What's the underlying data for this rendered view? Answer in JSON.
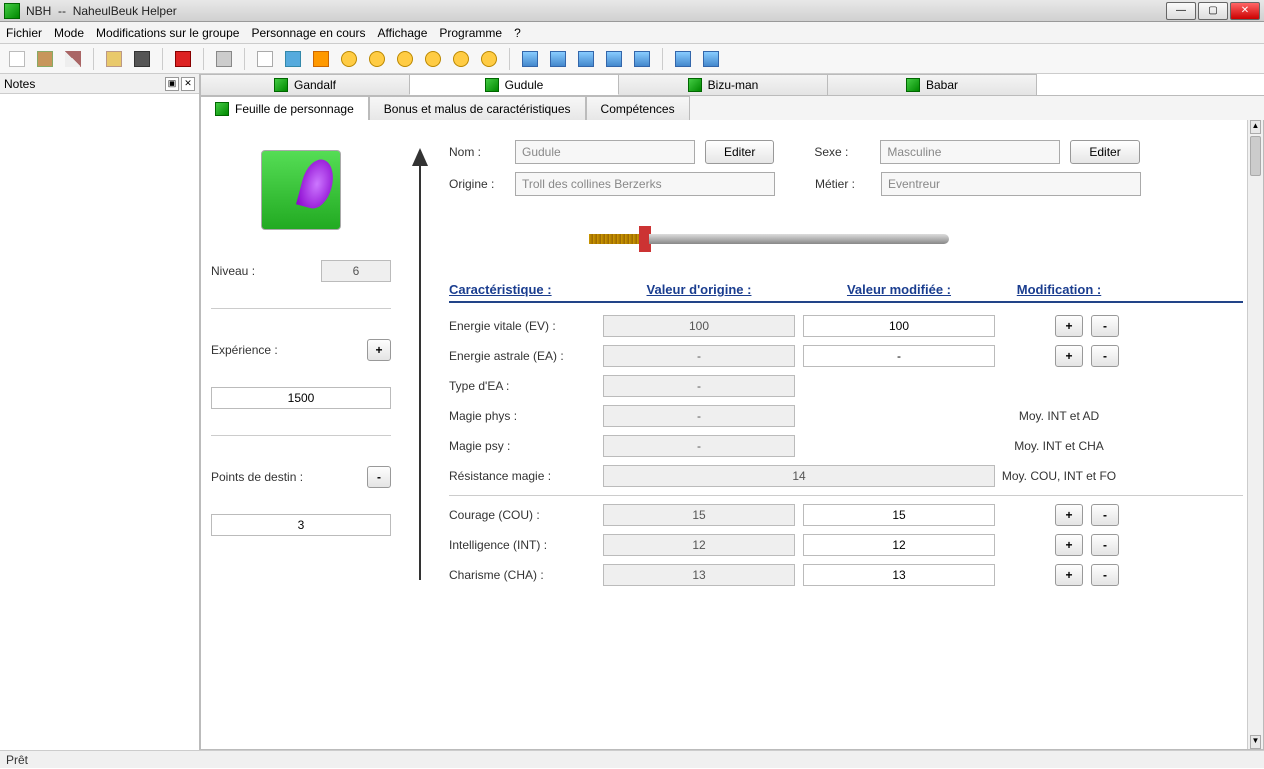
{
  "window": {
    "app": "NBH",
    "sep": "--",
    "title": "NaheulBeuk Helper"
  },
  "menu": [
    "Fichier",
    "Mode",
    "Modifications sur le groupe",
    "Personnage en cours",
    "Affichage",
    "Programme",
    "?"
  ],
  "notes": {
    "title": "Notes"
  },
  "char_tabs": [
    "Gandalf",
    "Gudule",
    "Bizu-man",
    "Babar"
  ],
  "char_active": 1,
  "sub_tabs": [
    "Feuille de personnage",
    "Bonus et malus de caractéristiques",
    "Compétences"
  ],
  "sub_active": 0,
  "fields": {
    "nom_label": "Nom :",
    "nom": "Gudule",
    "editer": "Editer",
    "sexe_label": "Sexe :",
    "sexe": "Masculine",
    "origine_label": "Origine :",
    "origine": "Troll des collines Berzerks",
    "metier_label": "Métier :",
    "metier": "Eventreur"
  },
  "left": {
    "niveau_label": "Niveau :",
    "niveau": "6",
    "exp_label": "Expérience :",
    "exp": "1500",
    "plus": "+",
    "destin_label": "Points de destin :",
    "destin": "3",
    "minus": "-"
  },
  "headers": {
    "car": "Caractéristique :",
    "vo": "Valeur d'origine :",
    "vm": "Valeur modifiée :",
    "mod": "Modification :"
  },
  "stats": [
    {
      "label": "Energie vitale (EV) :",
      "vo": "100",
      "vm": "100",
      "plus": true,
      "minus": true
    },
    {
      "label": "Energie astrale (EA) :",
      "vo": "-",
      "vm": "-",
      "plus": true,
      "minus": true
    },
    {
      "label": "Type d'EA :",
      "vo": "-",
      "vm": "",
      "note": ""
    },
    {
      "label": "Magie phys :",
      "vo": "-",
      "vm": "",
      "note": "Moy. INT et AD"
    },
    {
      "label": "Magie psy :",
      "vo": "-",
      "vm": "",
      "note": "Moy. INT et CHA"
    },
    {
      "label": "Résistance magie :",
      "vo": "14",
      "vm": "",
      "wide": true,
      "note": "Moy. COU, INT et FO"
    }
  ],
  "stats2": [
    {
      "label": "Courage (COU) :",
      "vo": "15",
      "vm": "15"
    },
    {
      "label": "Intelligence (INT) :",
      "vo": "12",
      "vm": "12"
    },
    {
      "label": "Charisme (CHA) :",
      "vo": "13",
      "vm": "13"
    }
  ],
  "btn": {
    "plus": "+",
    "minus": "-"
  },
  "status": "Prêt"
}
